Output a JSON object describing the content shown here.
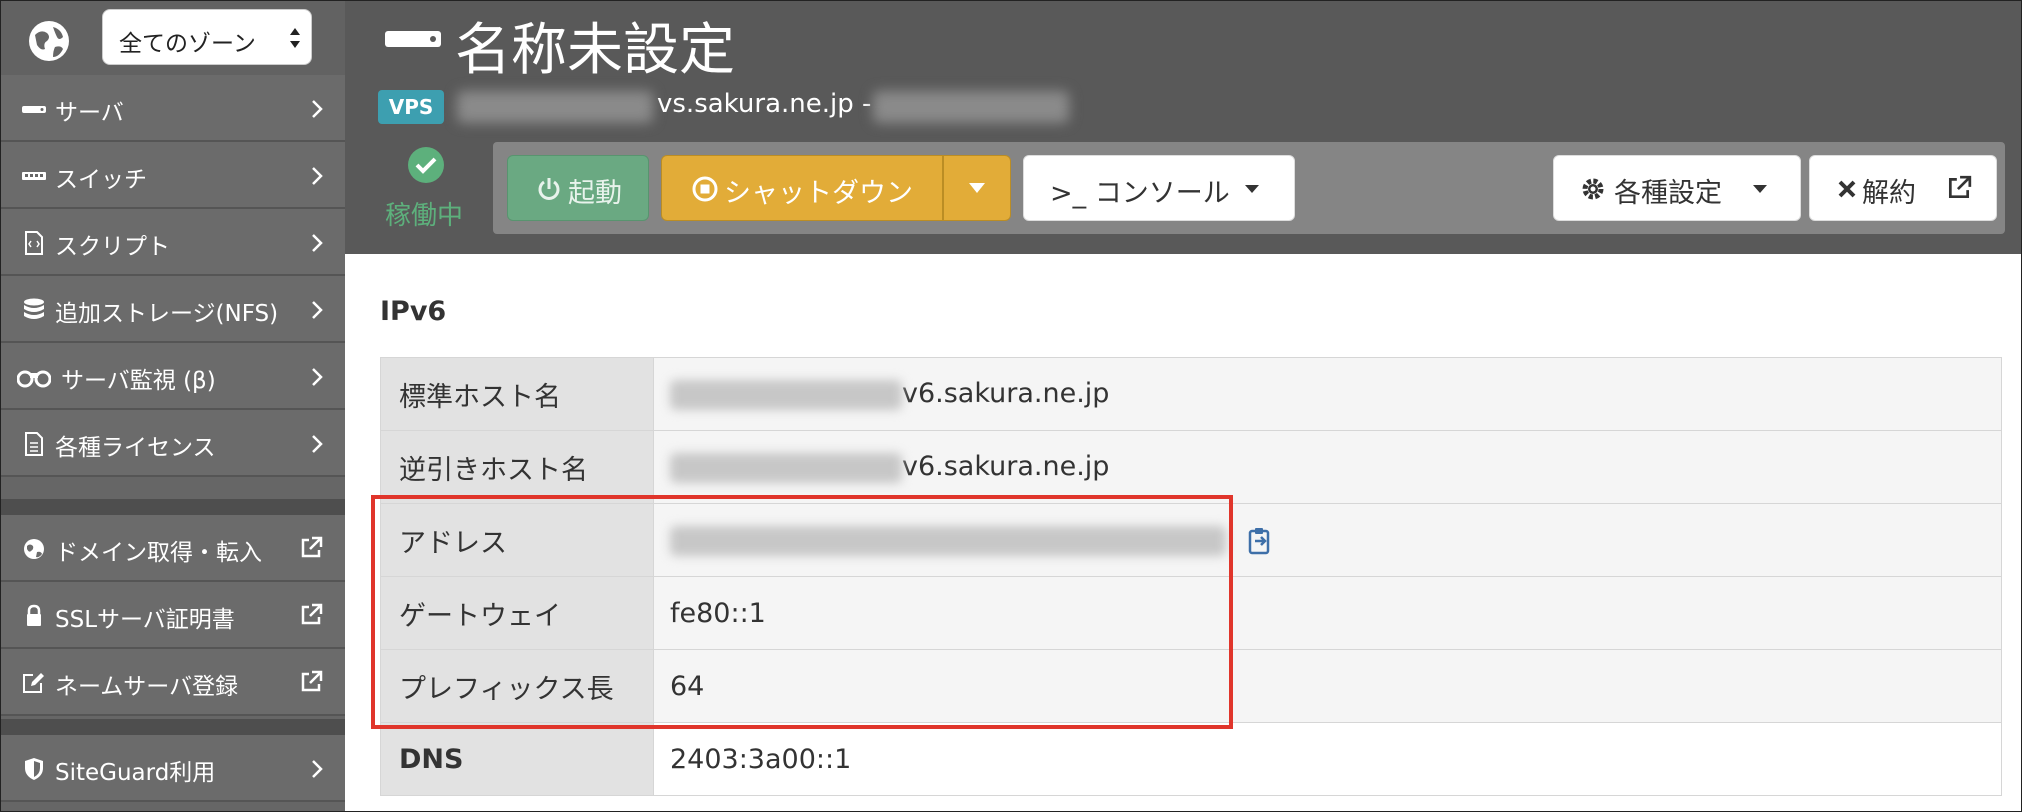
{
  "sidebar": {
    "zone_select": "全てのゾーン",
    "items": [
      {
        "label": "サーバ",
        "icon": "server-icon"
      },
      {
        "label": "スイッチ",
        "icon": "switch-icon"
      },
      {
        "label": "スクリプト",
        "icon": "script-icon"
      },
      {
        "label": "追加ストレージ(NFS)",
        "icon": "database-icon"
      },
      {
        "label": "サーバ監視 (β)",
        "icon": "binoculars-icon"
      },
      {
        "label": "各種ライセンス",
        "icon": "document-icon"
      },
      {
        "label": "ドメイン取得・転入",
        "icon": "globe-icon"
      },
      {
        "label": "SSLサーバ証明書",
        "icon": "lock-icon"
      },
      {
        "label": "ネームサーバ登録",
        "icon": "edit-icon"
      },
      {
        "label": "SiteGuard利用",
        "icon": "shield-icon"
      }
    ]
  },
  "header": {
    "title": "名称未設定",
    "badge": "VPS",
    "host_suffix": "vs.sakura.ne.jp -",
    "status": "稼働中",
    "buttons": {
      "start": "起動",
      "shutdown": "シャットダウン",
      "console": ">_ コンソール",
      "settings": "各種設定",
      "cancel": "解約"
    }
  },
  "ipv6": {
    "section_title": "IPv6",
    "rows": [
      {
        "key": "標準ホスト名",
        "value": "v6.sakura.ne.jp"
      },
      {
        "key": "逆引きホスト名",
        "value": "v6.sakura.ne.jp"
      },
      {
        "key": "アドレス",
        "value": ""
      },
      {
        "key": "ゲートウェイ",
        "value": "fe80::1"
      },
      {
        "key": "プレフィックス長",
        "value": "64"
      },
      {
        "key": "DNS",
        "value": "2403:3a00::1"
      }
    ]
  },
  "colors": {
    "accent_vps": "#3d9fb0",
    "status_green": "#5db07c",
    "shutdown_yellow": "#e2ac38",
    "highlight_red": "#e0352b"
  }
}
